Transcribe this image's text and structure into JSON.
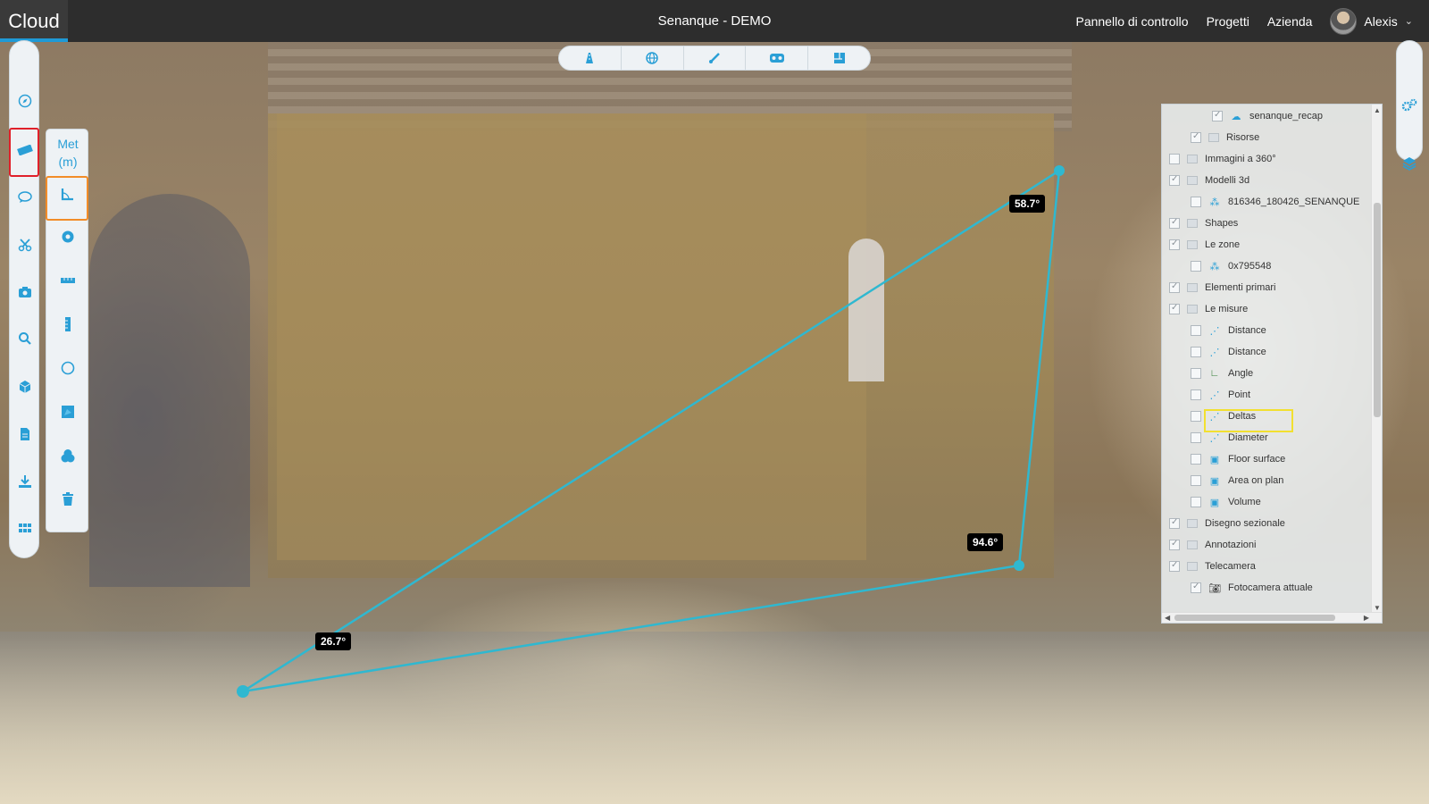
{
  "header": {
    "logo": "Cloud",
    "title": "Senanque - DEMO",
    "nav": [
      "Pannello di controllo",
      "Progetti",
      "Azienda"
    ],
    "user_name": "Alexis"
  },
  "colors": {
    "accent": "#2a9fd6",
    "measure_line": "#2fb8d0",
    "left_highlight": "#e0202a",
    "sub_highlight": "#f28c28",
    "tree_highlight": "#f2e030"
  },
  "center_toolbar": {
    "icons": [
      "road-icon",
      "globe-icon",
      "brush-icon",
      "vr-headset-icon",
      "floor-plan-icon"
    ]
  },
  "left_toolbar": {
    "icons": [
      "compass-icon",
      "ruler-icon",
      "comment-icon",
      "scissors-icon",
      "camera-icon",
      "search-icon",
      "cube-icon",
      "document-icon",
      "download-icon",
      "grid-icon"
    ]
  },
  "measure_toolbar": {
    "unit_line1": "Met",
    "unit_line2": "(m)",
    "tools": [
      "angle-icon",
      "point-icon",
      "distance-icon",
      "height-icon",
      "circle-icon",
      "area-icon",
      "volume-icon",
      "trash-icon"
    ]
  },
  "right_tools": {
    "icons": [
      "settings-icon",
      "layers-icon"
    ]
  },
  "angles": {
    "a1": "58.7°",
    "a2": "94.6°",
    "a3": "26.7°"
  },
  "tree": {
    "items": [
      {
        "label": "senanque_recap",
        "indent": 2,
        "type": "cloud"
      },
      {
        "label": "Risorse",
        "indent": 1,
        "type": "folder"
      },
      {
        "label": "Immagini a 360°",
        "indent": 0,
        "type": "folder"
      },
      {
        "label": "Modelli 3d",
        "indent": 0,
        "type": "folder"
      },
      {
        "label": "816346_180426_SENANQUE",
        "indent": 1,
        "type": "model"
      },
      {
        "label": "Shapes",
        "indent": 0,
        "type": "folder"
      },
      {
        "label": "Le zone",
        "indent": 0,
        "type": "folder"
      },
      {
        "label": "0x795548",
        "indent": 1,
        "type": "model"
      },
      {
        "label": "Elementi primari",
        "indent": 0,
        "type": "folder"
      },
      {
        "label": "Le misure",
        "indent": 0,
        "type": "folder"
      },
      {
        "label": "Distance",
        "indent": 1,
        "type": "measure"
      },
      {
        "label": "Distance",
        "indent": 1,
        "type": "measure"
      },
      {
        "label": "Angle",
        "indent": 1,
        "type": "angle"
      },
      {
        "label": "Point",
        "indent": 1,
        "type": "measure"
      },
      {
        "label": "Deltas",
        "indent": 1,
        "type": "measure"
      },
      {
        "label": "Diameter",
        "indent": 1,
        "type": "measure"
      },
      {
        "label": "Floor surface",
        "indent": 1,
        "type": "area"
      },
      {
        "label": "Area on plan",
        "indent": 1,
        "type": "area"
      },
      {
        "label": "Volume",
        "indent": 1,
        "type": "area"
      },
      {
        "label": "Disegno sezionale",
        "indent": 0,
        "type": "folder"
      },
      {
        "label": "Annotazioni",
        "indent": 0,
        "type": "folder"
      },
      {
        "label": "Telecamera",
        "indent": 0,
        "type": "folder"
      },
      {
        "label": "Fotocamera attuale",
        "indent": 1,
        "type": "camera"
      }
    ]
  }
}
